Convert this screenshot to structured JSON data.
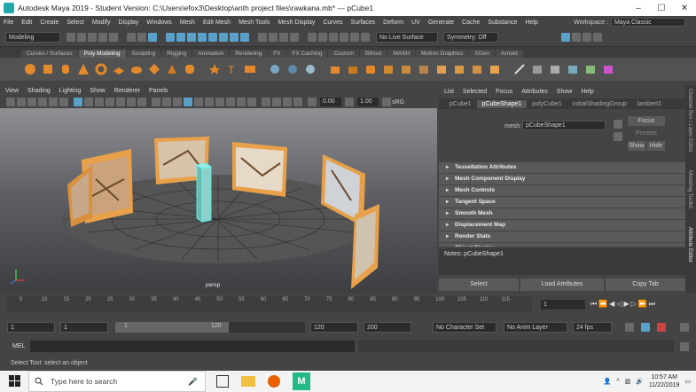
{
  "window": {
    "title": "Autodesk Maya 2019 - Student Version: C:\\Users\\efox3\\Desktop\\anth project files\\rawkana.mb*   ---   pCube1"
  },
  "menubar": [
    "File",
    "Edit",
    "Create",
    "Select",
    "Modify",
    "Display",
    "Windows",
    "Mesh",
    "Edit Mesh",
    "Mesh Tools",
    "Mesh Display",
    "Curves",
    "Surfaces",
    "Deform",
    "UV",
    "Generate",
    "Cache",
    "Substance",
    "Help"
  ],
  "workspace": {
    "label": "Workspace :",
    "value": "Maya Classic"
  },
  "status": {
    "mode": "Modeling",
    "live_surface": "No Live Surface",
    "symmetry": "Symmetry: Off"
  },
  "shelf_tabs": [
    "Curves / Surfaces",
    "Poly Modeling",
    "Sculpting",
    "Rigging",
    "Animation",
    "Rendering",
    "FX",
    "FX Caching",
    "Custom",
    "Bifrost",
    "MASH",
    "Motion Graphics",
    "XGen",
    "Arnold"
  ],
  "shelf_active": "Poly Modeling",
  "viewport": {
    "menu": [
      "View",
      "Shading",
      "Lighting",
      "Show",
      "Renderer",
      "Panels"
    ],
    "val1": "0.00",
    "val2": "1.00",
    "colorspace": "sRG",
    "camera": "persp"
  },
  "attr": {
    "menu": [
      "List",
      "Selected",
      "Focus",
      "Attributes",
      "Show",
      "Help"
    ],
    "tabs": [
      "pCube1",
      "pCubeShape1",
      "polyCube1",
      "initialShadingGroup",
      "lambert1"
    ],
    "active_tab": "pCubeShape1",
    "mesh_label": "mesh:",
    "mesh_value": "pCubeShape1",
    "focus_btn": "Focus",
    "presets_btn": "Presets",
    "show_btn": "Show",
    "hide_btn": "Hide",
    "sections": [
      "Tessellation Attributes",
      "Mesh Component Display",
      "Mesh Controls",
      "Tangent Space",
      "Smooth Mesh",
      "Displacement Map",
      "Render Stats",
      "Object Display"
    ],
    "notes": "Notes: pCubeShape1",
    "select_btn": "Select",
    "load_btn": "Load Attributes",
    "copy_btn": "Copy Tab"
  },
  "side_tabs": [
    "Channel Box / Layer Editor",
    "Modeling Toolkit",
    "Attribute Editor"
  ],
  "timeline": {
    "ticks": [
      "5",
      "10",
      "15",
      "20",
      "25",
      "30",
      "35",
      "40",
      "45",
      "50",
      "55",
      "60",
      "65",
      "70",
      "75",
      "80",
      "85",
      "90",
      "95",
      "100",
      "105",
      "110",
      "115"
    ],
    "current": "1"
  },
  "range": {
    "start": "1",
    "anim_start": "1",
    "slider_start": "1",
    "slider_end": "120",
    "end": "120",
    "anim_end": "200",
    "character": "No Character Set",
    "anim_layer": "No Anim Layer",
    "fps": "24 fps"
  },
  "cmd": {
    "label": "MEL"
  },
  "help_line": "Select Tool: select an object",
  "taskbar": {
    "search_placeholder": "Type here to search",
    "time": "10:57 AM",
    "date": "11/22/2019"
  }
}
